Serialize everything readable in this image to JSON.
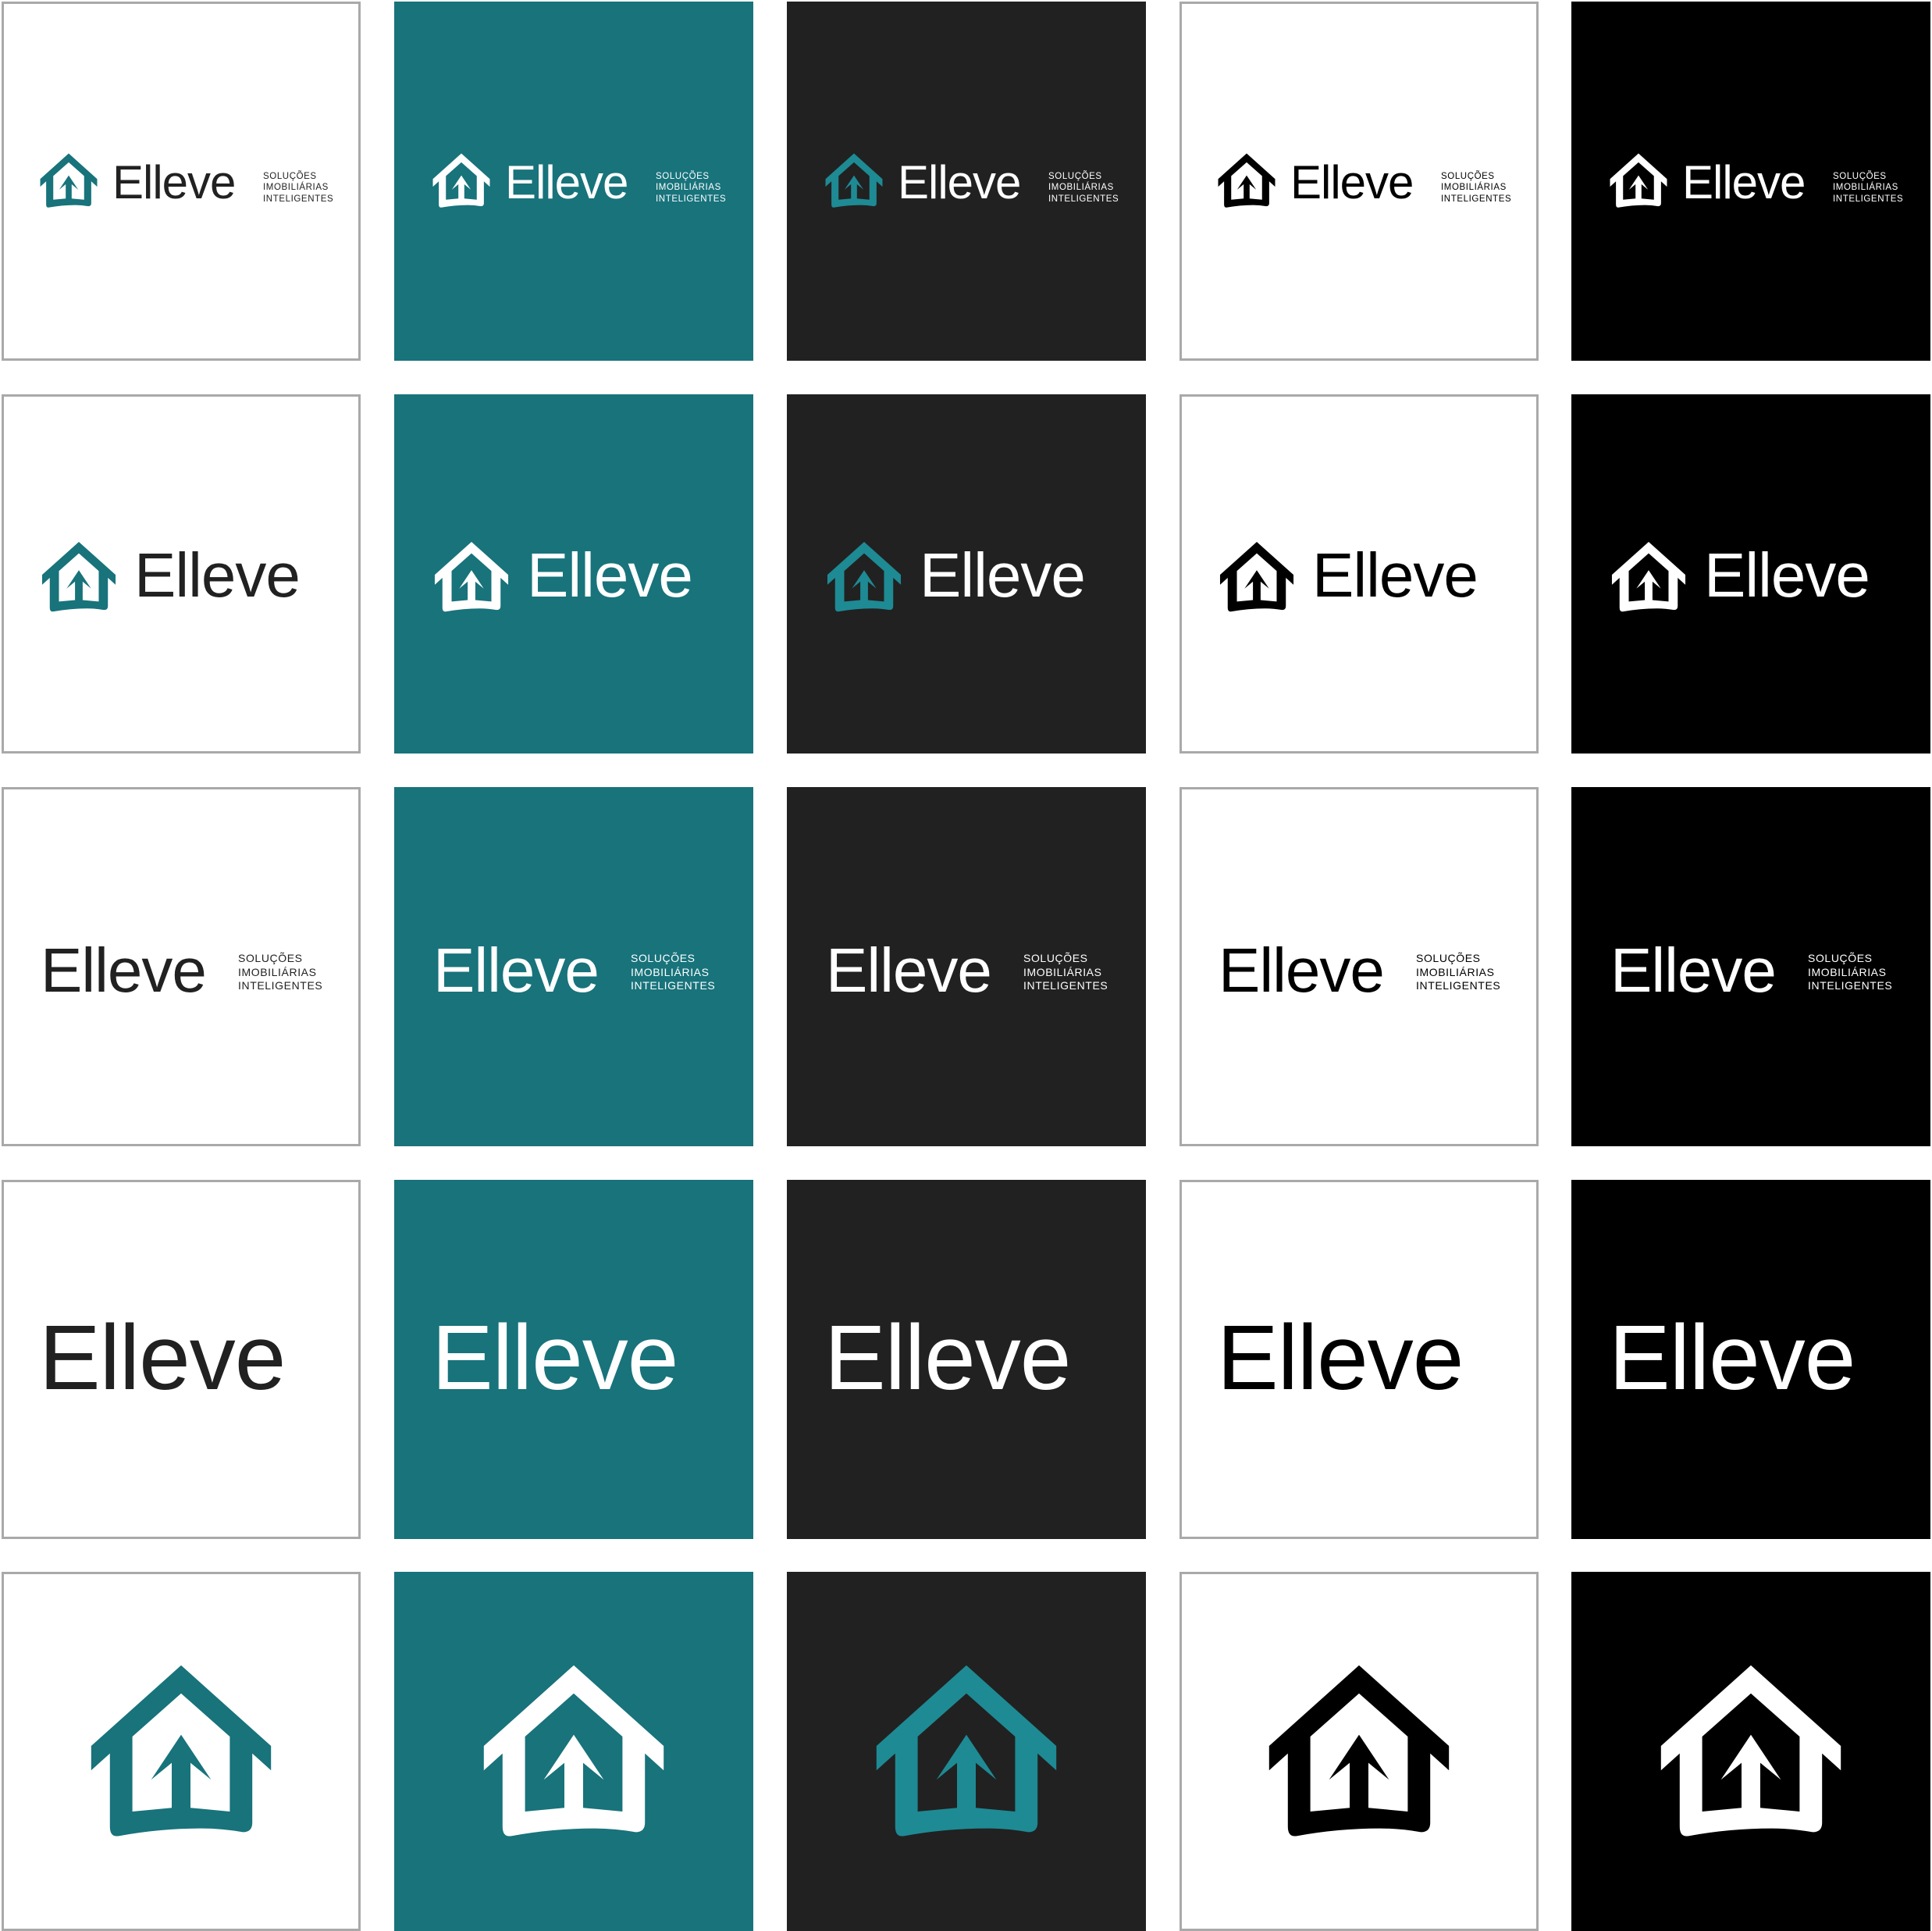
{
  "brand": {
    "name": "Elleve",
    "tagline": [
      "SOLUÇÕES",
      "IMOBILIÁRIAS",
      "INTELIGENTES"
    ]
  },
  "icons": {
    "mark": "house-arrow-icon"
  },
  "colors": {
    "teal": "#18737b",
    "teal_light": "#1e8a94",
    "charcoal": "#212121",
    "black": "#000000",
    "white": "#ffffff",
    "border": "#a9a9a9"
  },
  "palettes": [
    {
      "name": "white",
      "bg": "#ffffff",
      "mark": "#18737b",
      "text": "#212121",
      "bordered": true
    },
    {
      "name": "teal",
      "bg": "#18737b",
      "mark": "#ffffff",
      "text": "#ffffff",
      "bordered": false
    },
    {
      "name": "charcoal",
      "bg": "#212121",
      "mark": "#1e8a94",
      "text": "#ffffff",
      "bordered": false
    },
    {
      "name": "white-mono",
      "bg": "#ffffff",
      "mark": "#000000",
      "text": "#000000",
      "bordered": true
    },
    {
      "name": "black",
      "bg": "#000000",
      "mark": "#ffffff",
      "text": "#ffffff",
      "bordered": false
    }
  ],
  "variants": [
    "full-horizontal",
    "icon-wordmark",
    "wordmark-tagline",
    "wordmark",
    "icon"
  ]
}
